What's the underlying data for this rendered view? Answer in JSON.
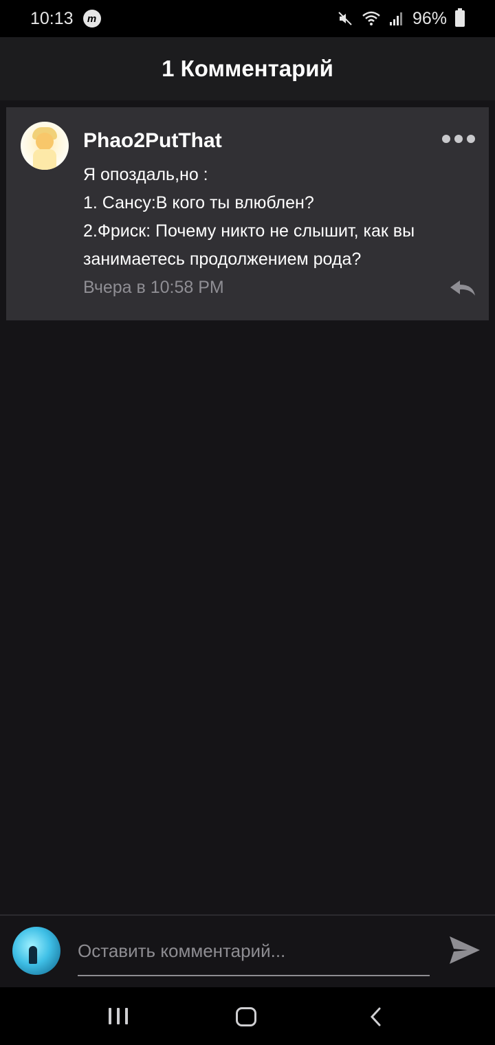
{
  "status_bar": {
    "time": "10:13",
    "app_icon": "messenger-m-icon",
    "battery": "96%"
  },
  "header": {
    "title": "1 Комментарий"
  },
  "comment": {
    "author": "Phao2PutThat",
    "lines": [
      "Я опоздаль,но :",
      "1. Сансу:В кого ты влюблен?",
      "2.Фриск: Почему никто не слышит, как вы занимаетесь продолжением рода?"
    ],
    "timestamp": "Вчера в 10:58 PM",
    "avatar_icon": "user-avatar-icon",
    "more_icon": "more-dots-icon",
    "reply_icon": "reply-arrow-icon"
  },
  "composer": {
    "placeholder": "Оставить комментарий...",
    "send_icon": "send-icon"
  },
  "colors": {
    "background": "#151417",
    "card": "#313034",
    "header": "#1c1c1e",
    "muted_text": "#8f8e94"
  }
}
